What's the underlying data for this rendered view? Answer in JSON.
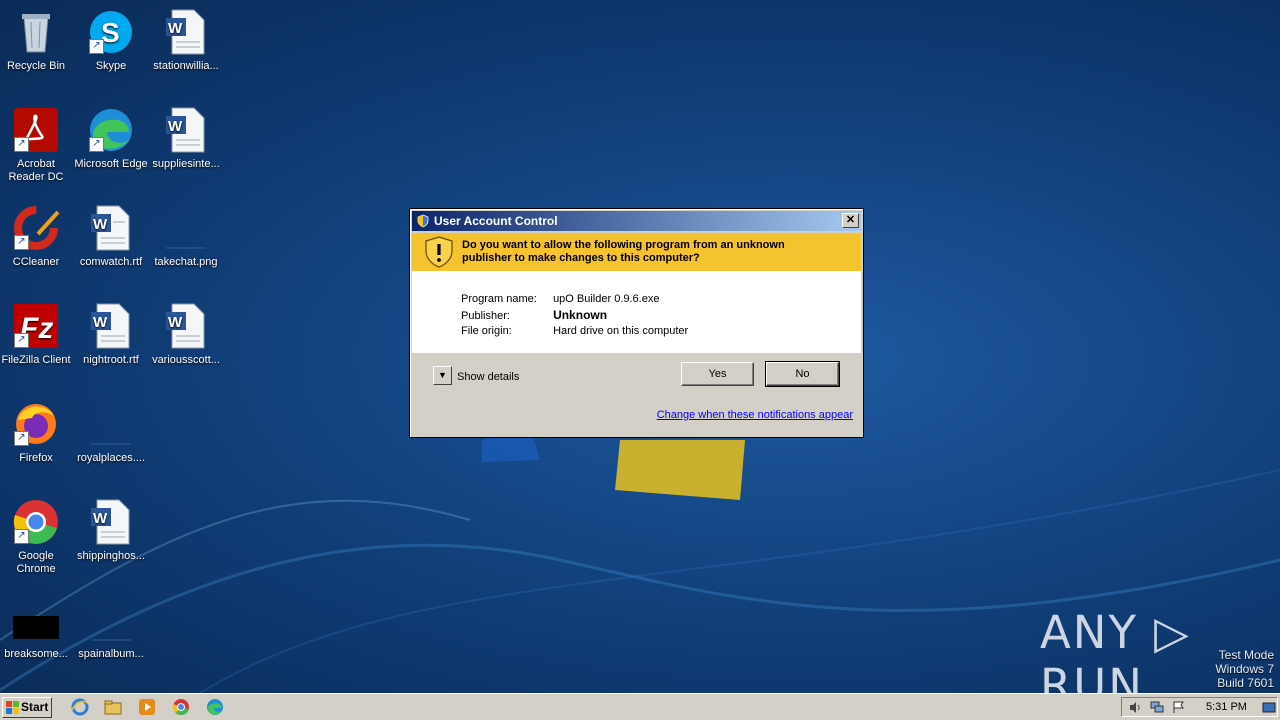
{
  "desktop": {
    "icons": [
      {
        "label": "Recycle Bin",
        "icon": "recycle-bin-icon"
      },
      {
        "label": "Skype",
        "icon": "skype-icon"
      },
      {
        "label": "stationwillia...",
        "icon": "word-document-icon"
      },
      {
        "label": "Acrobat Reader DC",
        "icon": "acrobat-reader-icon"
      },
      {
        "label": "Microsoft Edge",
        "icon": "edge-icon"
      },
      {
        "label": "suppliesinte...",
        "icon": "word-document-icon"
      },
      {
        "label": "CCleaner",
        "icon": "ccleaner-icon"
      },
      {
        "label": "comwatch.rtf",
        "icon": "word-document-icon"
      },
      {
        "label": "takechat.png",
        "icon": "image-file-icon"
      },
      {
        "label": "FileZilla Client",
        "icon": "filezilla-icon"
      },
      {
        "label": "nightroot.rtf",
        "icon": "word-document-icon"
      },
      {
        "label": "variousscott...",
        "icon": "word-document-icon"
      },
      {
        "label": "Firefox",
        "icon": "firefox-icon"
      },
      {
        "label": "royalplaces....",
        "icon": "blank-file-icon"
      },
      {
        "label": "Google Chrome",
        "icon": "chrome-icon"
      },
      {
        "label": "shippinghos...",
        "icon": "word-document-icon"
      },
      {
        "label": "breaksome...",
        "icon": "black-file-icon"
      },
      {
        "label": "spainalbum...",
        "icon": "blank-file-icon"
      }
    ]
  },
  "uac": {
    "title": "User Account Control",
    "question": "Do you want to allow the following program from an unknown publisher to make changes to this computer?",
    "program_name_label": "Program name:",
    "program_name": "upO Builder 0.9.6.exe",
    "publisher_label": "Publisher:",
    "publisher": "Unknown",
    "file_origin_label": "File origin:",
    "file_origin": "Hard drive on this computer",
    "show_details": "Show details",
    "yes": "Yes",
    "no": "No",
    "change_link": "Change when these notifications appear",
    "close_glyph": "✕"
  },
  "watermark": {
    "brand": "ANY ▷ RUN",
    "mode_line1": "Test Mode",
    "mode_line2": "Windows 7",
    "mode_line3": "Build 7601"
  },
  "taskbar": {
    "start": "Start",
    "clock": "5:31 PM",
    "pinned": [
      "ie-icon",
      "explorer-icon",
      "media-player-icon",
      "chrome-icon",
      "edge-icon"
    ]
  },
  "colors": {
    "banner": "#f5c230",
    "title_gradient_start": "#0a246a",
    "title_gradient_end": "#a6caf0",
    "link": "#0000ff"
  }
}
